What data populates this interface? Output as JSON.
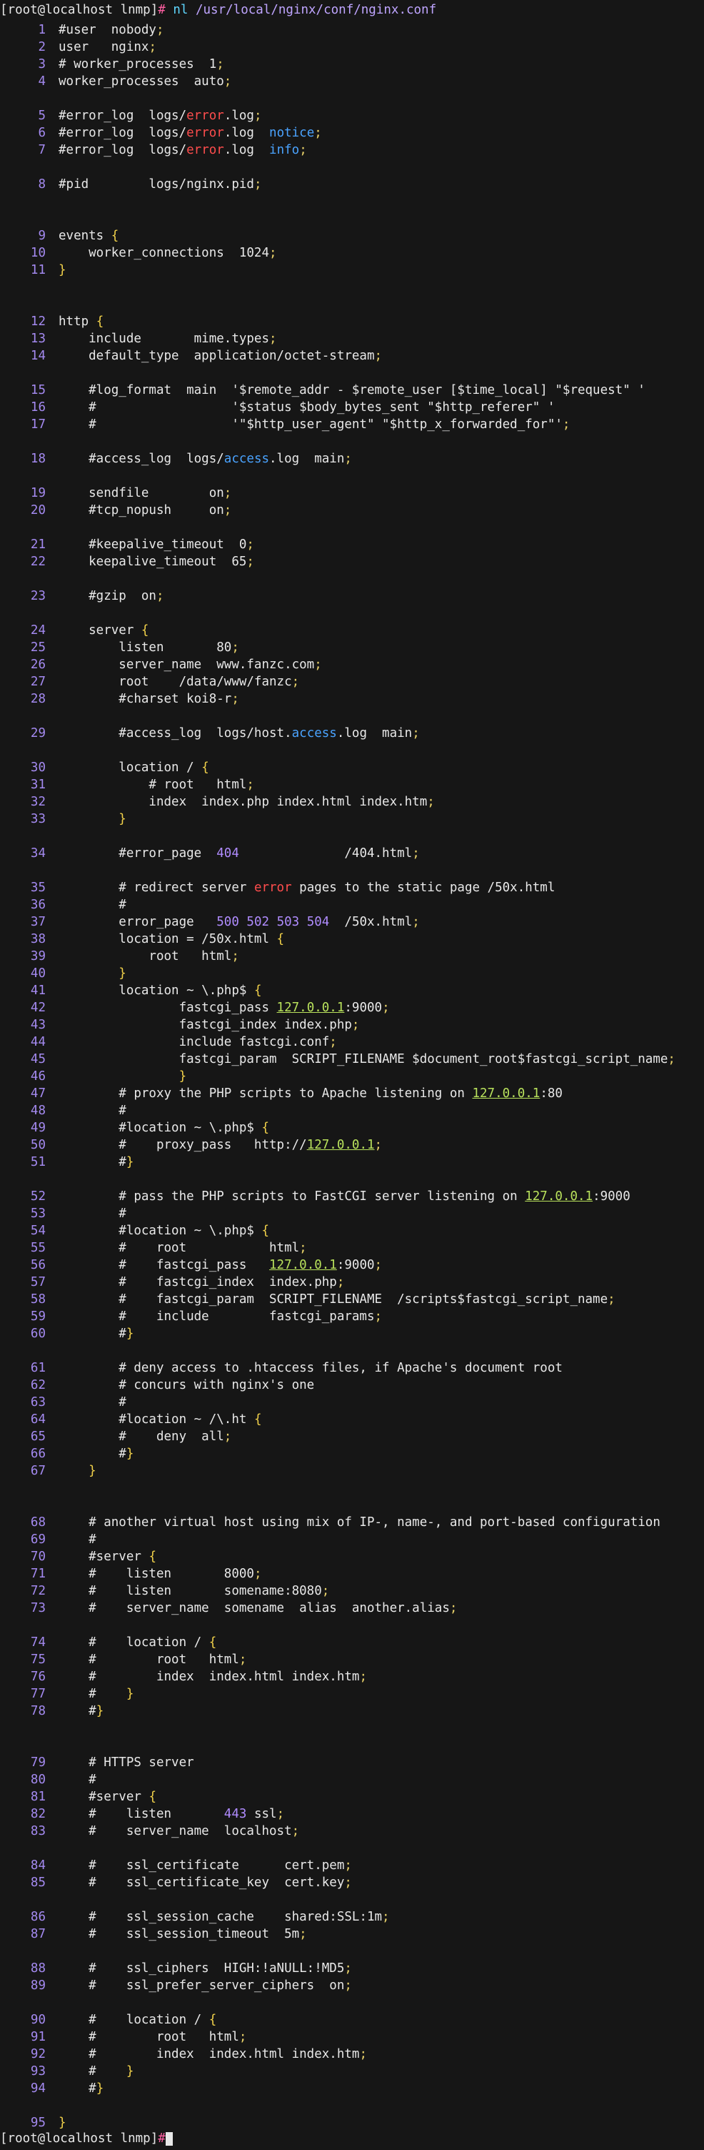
{
  "terminal": {
    "prompt": "[root@localhost lnmp]",
    "prompt_symbol": "#",
    "command": "nl",
    "command_arg": "/usr/local/nginx/conf/nginx.conf"
  },
  "lines": [
    {
      "n": "1",
      "t": "#user  nobody;"
    },
    {
      "n": "2",
      "t": "user   nginx;"
    },
    {
      "n": "3",
      "t": "# worker_processes  1;"
    },
    {
      "n": "4",
      "t": "worker_processes  auto;"
    },
    {
      "n": "5",
      "t": "#error_log  logs/error.log;"
    },
    {
      "n": "6",
      "t": "#error_log  logs/error.log  notice;"
    },
    {
      "n": "7",
      "t": "#error_log  logs/error.log  info;"
    },
    {
      "n": "8",
      "t": "#pid        logs/nginx.pid;"
    },
    {
      "n": "9",
      "t": "events {"
    },
    {
      "n": "10",
      "t": "    worker_connections  1024;"
    },
    {
      "n": "11",
      "t": "}"
    },
    {
      "n": "12",
      "t": "http {"
    },
    {
      "n": "13",
      "t": "    include       mime.types;"
    },
    {
      "n": "14",
      "t": "    default_type  application/octet-stream;"
    },
    {
      "n": "15",
      "t": "    #log_format  main  '$remote_addr - $remote_user [$time_local] \"$request\" '"
    },
    {
      "n": "16",
      "t": "    #                  '$status $body_bytes_sent \"$http_referer\" '"
    },
    {
      "n": "17",
      "t": "    #                  '\"$http_user_agent\" \"$http_x_forwarded_for\"';"
    },
    {
      "n": "18",
      "t": "    #access_log  logs/access.log  main;"
    },
    {
      "n": "19",
      "t": "    sendfile        on;"
    },
    {
      "n": "20",
      "t": "    #tcp_nopush     on;"
    },
    {
      "n": "21",
      "t": "    #keepalive_timeout  0;"
    },
    {
      "n": "22",
      "t": "    keepalive_timeout  65;"
    },
    {
      "n": "23",
      "t": "    #gzip  on;"
    },
    {
      "n": "24",
      "t": "    server {"
    },
    {
      "n": "25",
      "t": "        listen       80;"
    },
    {
      "n": "26",
      "t": "        server_name  www.fanzc.com;"
    },
    {
      "n": "27",
      "t": "        root    /data/www/fanzc;"
    },
    {
      "n": "28",
      "t": "        #charset koi8-r;"
    },
    {
      "n": "29",
      "t": "        #access_log  logs/host.access.log  main;"
    },
    {
      "n": "30",
      "t": "        location / {"
    },
    {
      "n": "31",
      "t": "            # root   html;"
    },
    {
      "n": "32",
      "t": "            index  index.php index.html index.htm;"
    },
    {
      "n": "33",
      "t": "        }"
    },
    {
      "n": "34",
      "t": "        #error_page  404              /404.html;"
    },
    {
      "n": "35",
      "t": "        # redirect server error pages to the static page /50x.html"
    },
    {
      "n": "36",
      "t": "        #"
    },
    {
      "n": "37",
      "t": "        error_page   500 502 503 504  /50x.html;"
    },
    {
      "n": "38",
      "t": "        location = /50x.html {"
    },
    {
      "n": "39",
      "t": "            root   html;"
    },
    {
      "n": "40",
      "t": "        }"
    },
    {
      "n": "41",
      "t": "        location ~ \\.php$ {"
    },
    {
      "n": "42",
      "t": "                fastcgi_pass 127.0.0.1:9000;"
    },
    {
      "n": "43",
      "t": "                fastcgi_index index.php;"
    },
    {
      "n": "44",
      "t": "                include fastcgi.conf;"
    },
    {
      "n": "45",
      "t": "                fastcgi_param  SCRIPT_FILENAME $document_root$fastcgi_script_name;"
    },
    {
      "n": "46",
      "t": "                }"
    },
    {
      "n": "47",
      "t": "        # proxy the PHP scripts to Apache listening on 127.0.0.1:80"
    },
    {
      "n": "48",
      "t": "        #"
    },
    {
      "n": "49",
      "t": "        #location ~ \\.php$ {"
    },
    {
      "n": "50",
      "t": "        #    proxy_pass   http://127.0.0.1;"
    },
    {
      "n": "51",
      "t": "        #}"
    },
    {
      "n": "52",
      "t": "        # pass the PHP scripts to FastCGI server listening on 127.0.0.1:9000"
    },
    {
      "n": "53",
      "t": "        #"
    },
    {
      "n": "54",
      "t": "        #location ~ \\.php$ {"
    },
    {
      "n": "55",
      "t": "        #    root           html;"
    },
    {
      "n": "56",
      "t": "        #    fastcgi_pass   127.0.0.1:9000;"
    },
    {
      "n": "57",
      "t": "        #    fastcgi_index  index.php;"
    },
    {
      "n": "58",
      "t": "        #    fastcgi_param  SCRIPT_FILENAME  /scripts$fastcgi_script_name;"
    },
    {
      "n": "59",
      "t": "        #    include        fastcgi_params;"
    },
    {
      "n": "60",
      "t": "        #}"
    },
    {
      "n": "61",
      "t": "        # deny access to .htaccess files, if Apache's document root"
    },
    {
      "n": "62",
      "t": "        # concurs with nginx's one"
    },
    {
      "n": "63",
      "t": "        #"
    },
    {
      "n": "64",
      "t": "        #location ~ /\\.ht {"
    },
    {
      "n": "65",
      "t": "        #    deny  all;"
    },
    {
      "n": "66",
      "t": "        #}"
    },
    {
      "n": "67",
      "t": "    }"
    },
    {
      "n": "68",
      "t": "    # another virtual host using mix of IP-, name-, and port-based configuration"
    },
    {
      "n": "69",
      "t": "    #"
    },
    {
      "n": "70",
      "t": "    #server {"
    },
    {
      "n": "71",
      "t": "    #    listen       8000;"
    },
    {
      "n": "72",
      "t": "    #    listen       somename:8080;"
    },
    {
      "n": "73",
      "t": "    #    server_name  somename  alias  another.alias;"
    },
    {
      "n": "74",
      "t": "    #    location / {"
    },
    {
      "n": "75",
      "t": "    #        root   html;"
    },
    {
      "n": "76",
      "t": "    #        index  index.html index.htm;"
    },
    {
      "n": "77",
      "t": "    #    }"
    },
    {
      "n": "78",
      "t": "    #}"
    },
    {
      "n": "79",
      "t": "    # HTTPS server"
    },
    {
      "n": "80",
      "t": "    #"
    },
    {
      "n": "81",
      "t": "    #server {"
    },
    {
      "n": "82",
      "t": "    #    listen       443 ssl;"
    },
    {
      "n": "83",
      "t": "    #    server_name  localhost;"
    },
    {
      "n": "84",
      "t": "    #    ssl_certificate      cert.pem;"
    },
    {
      "n": "85",
      "t": "    #    ssl_certificate_key  cert.key;"
    },
    {
      "n": "86",
      "t": "    #    ssl_session_cache    shared:SSL:1m;"
    },
    {
      "n": "87",
      "t": "    #    ssl_session_timeout  5m;"
    },
    {
      "n": "88",
      "t": "    #    ssl_ciphers  HIGH:!aNULL:!MD5;"
    },
    {
      "n": "89",
      "t": "    #    ssl_prefer_server_ciphers  on;"
    },
    {
      "n": "90",
      "t": "    #    location / {"
    },
    {
      "n": "91",
      "t": "    #        root   html;"
    },
    {
      "n": "92",
      "t": "    #        index  index.html index.htm;"
    },
    {
      "n": "93",
      "t": "    #    }"
    },
    {
      "n": "94",
      "t": "    #}"
    },
    {
      "n": "95",
      "t": "}"
    }
  ]
}
